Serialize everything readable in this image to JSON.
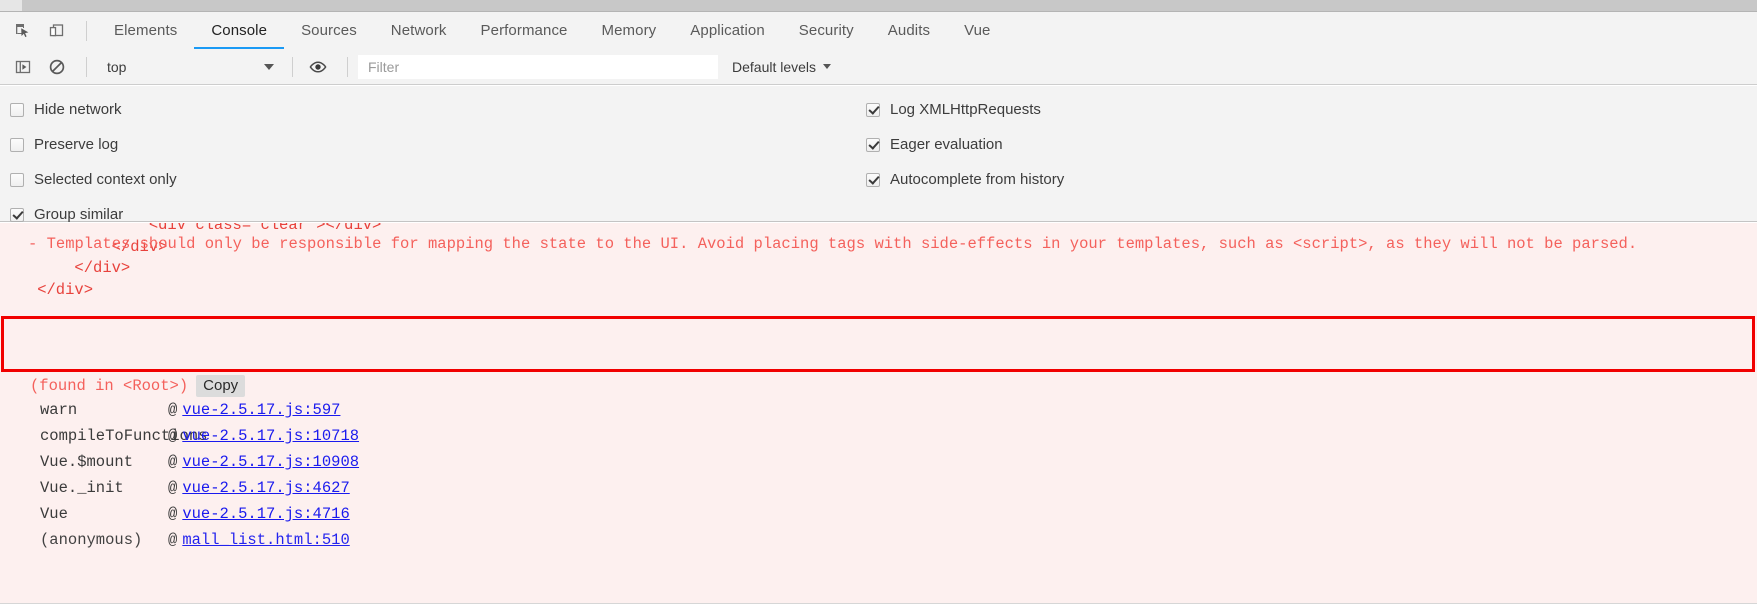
{
  "window": {
    "chrome_strip": ""
  },
  "tabbar": {
    "icons": [
      {
        "name": "inspect-element-icon",
        "title": "Inspect element"
      },
      {
        "name": "device-toolbar-icon",
        "title": "Toggle device toolbar"
      }
    ],
    "tabs": [
      {
        "label": "Elements",
        "active": false
      },
      {
        "label": "Console",
        "active": true
      },
      {
        "label": "Sources",
        "active": false
      },
      {
        "label": "Network",
        "active": false
      },
      {
        "label": "Performance",
        "active": false
      },
      {
        "label": "Memory",
        "active": false
      },
      {
        "label": "Application",
        "active": false
      },
      {
        "label": "Security",
        "active": false
      },
      {
        "label": "Audits",
        "active": false
      },
      {
        "label": "Vue",
        "active": false
      }
    ]
  },
  "console_toolbar": {
    "sidebar_toggle_icon": "console-sidebar-icon",
    "clear_icon": "clear-console-icon",
    "context_value": "top",
    "eye_icon": "live-expression-eye-icon",
    "filter_placeholder": "Filter",
    "filter_value": "",
    "levels_label": "Default levels"
  },
  "settings": {
    "left_column": [
      {
        "label": "Hide network",
        "checked": false
      },
      {
        "label": "Preserve log",
        "checked": false
      },
      {
        "label": "Selected context only",
        "checked": false
      },
      {
        "label": "Group similar",
        "checked": true
      }
    ],
    "right_column": [
      {
        "label": "Log XMLHttpRequests",
        "checked": true
      },
      {
        "label": "Eager evaluation",
        "checked": true
      },
      {
        "label": "Autocomplete from history",
        "checked": true
      }
    ]
  },
  "console_output": {
    "html_snippet_lines": [
      "                <div class=\"clear\"></div>",
      "            </div>",
      "        </div>",
      "    </div>"
    ],
    "highlighted_warning": "- Templates should only be responsible for mapping the state to the UI. Avoid placing tags with side-effects in your templates, such as <script>, as they will not be parsed.",
    "found_in": "(found in <Root>)",
    "copy_label": "Copy",
    "stack_frames": [
      {
        "fn": "warn",
        "at": "@",
        "source": "vue-2.5.17.js:597"
      },
      {
        "fn": "compileToFunctions",
        "at": "@",
        "source": "vue-2.5.17.js:10718"
      },
      {
        "fn": "Vue.$mount",
        "at": "@",
        "source": "vue-2.5.17.js:10908"
      },
      {
        "fn": "Vue._init",
        "at": "@",
        "source": "vue-2.5.17.js:4627"
      },
      {
        "fn": "Vue",
        "at": "@",
        "source": "vue-2.5.17.js:4716"
      },
      {
        "fn": "(anonymous)",
        "at": "@",
        "source": "mall_list.html:510"
      }
    ]
  },
  "colors": {
    "accent": "#1a9af5",
    "error_bg": "#fdf0ef",
    "error_text": "#e8423c",
    "highlight_border": "#f10000",
    "link": "#1a1aee",
    "panel_bg": "#f3f3f3"
  }
}
